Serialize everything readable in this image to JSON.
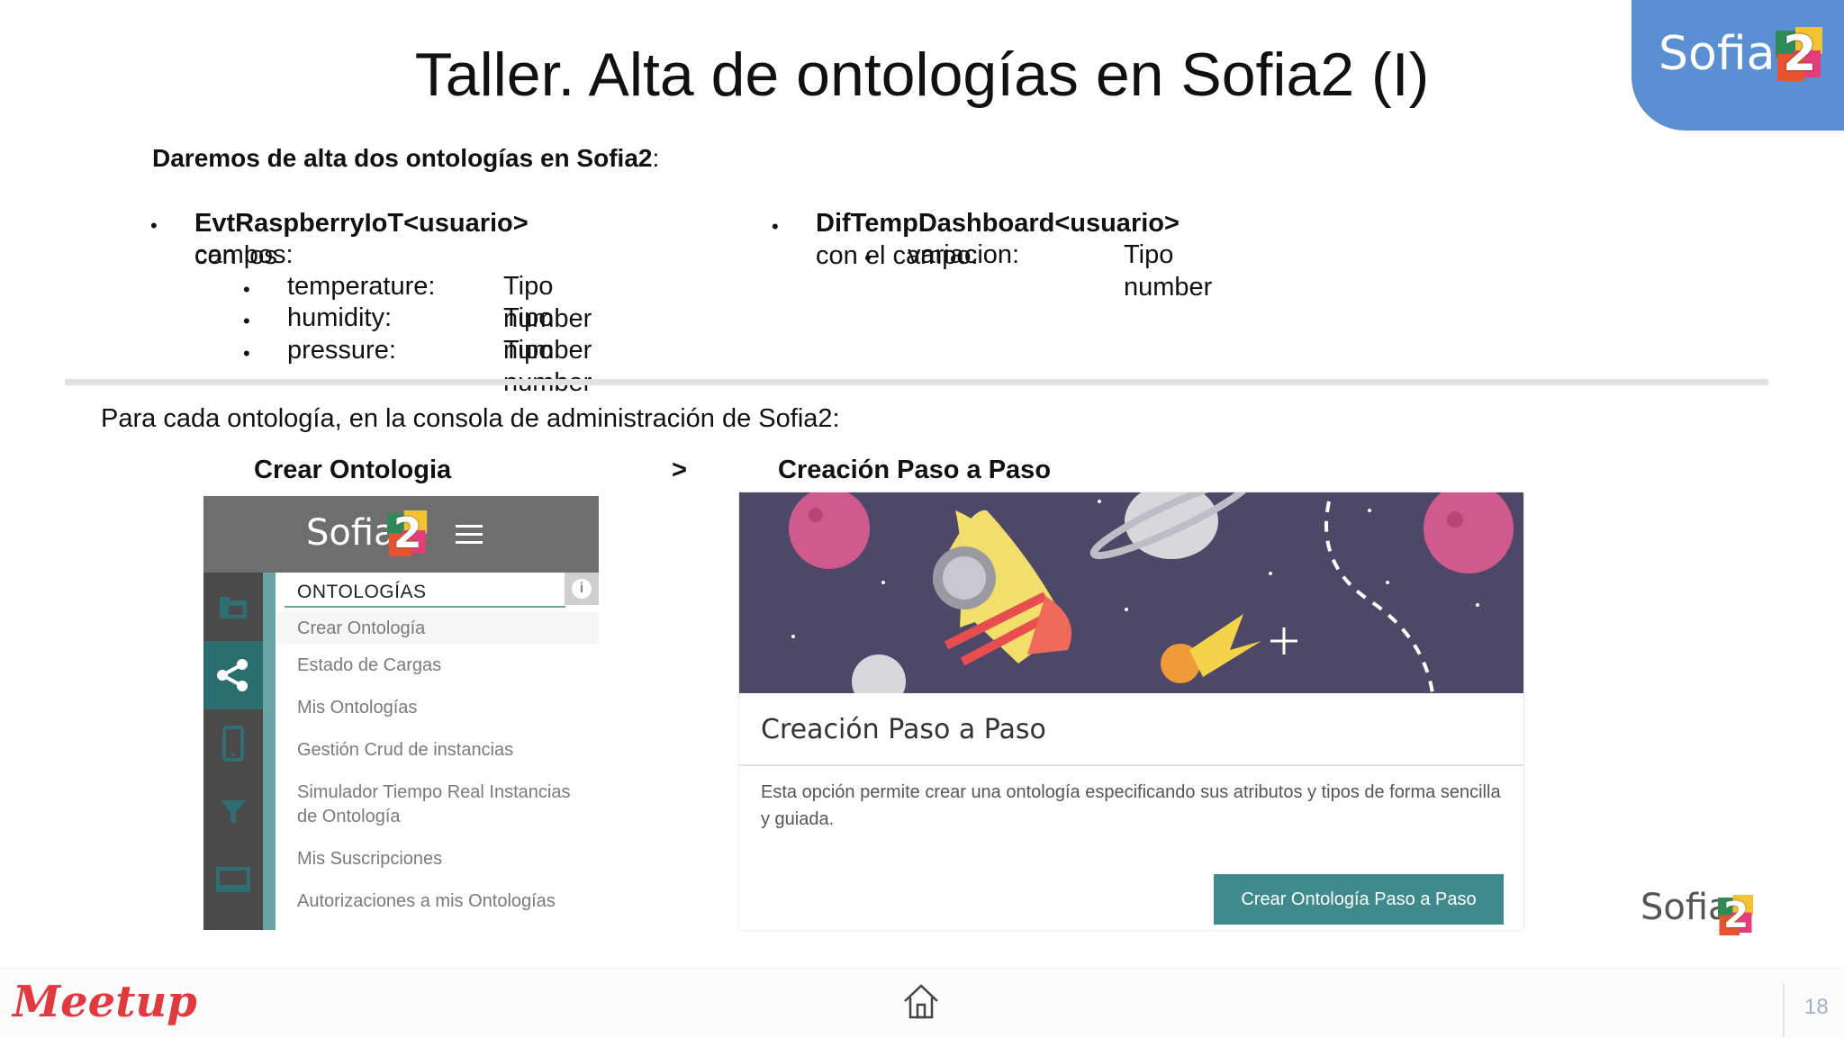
{
  "slide": {
    "title": "Taller. Alta de ontologías en Sofia2 (I)",
    "intro_bold": "Daremos de alta dos ontologías en Sofia2",
    "intro_rest": ":",
    "page_number": "18"
  },
  "left_ontology": {
    "name_bold": "EvtRaspberryIoT<usuario>",
    "name_rest": " con los",
    "line2": "campos:",
    "fields": [
      {
        "name": "temperature:",
        "type": "Tipo number"
      },
      {
        "name": "humidity:",
        "type": "Tipo number"
      },
      {
        "name": "pressure:",
        "type": "Tipo number"
      }
    ]
  },
  "right_ontology": {
    "name_bold": "DifTempDashboard<usuario>",
    "name_rest": " con el campo:",
    "fields": [
      {
        "name": "variacion:",
        "type": "Tipo number"
      }
    ]
  },
  "instructions": {
    "text": "Para cada ontología, en la consola de administración de Sofia2:",
    "step1": "Crear Ontologia",
    "arrow": ">",
    "step2": "Creación Paso a Paso"
  },
  "console_panel": {
    "brand": "Sofia",
    "brand_number": "2",
    "section_title": "ONTOLOGÍAS",
    "menu_items": [
      "Crear Ontología",
      "Estado de Cargas",
      "Mis Ontologías",
      "Gestión Crud de instancias",
      "Simulador Tiempo Real Instancias",
      "de Ontología",
      "Mis Suscripciones",
      "Autorizaciones a mis Ontologías"
    ],
    "rail_icons": [
      "folder-icon",
      "share-icon",
      "mobile-icon",
      "filter-icon",
      "monitor-icon"
    ]
  },
  "wizard_card": {
    "title": "Creación Paso a Paso",
    "description": "Esta opción permite crear una ontología especificando sus atributos y tipos de forma sencilla y guiada.",
    "button": "Crear Ontología Paso a Paso"
  },
  "branding": {
    "corner_logo": "Sofia",
    "corner_number": "2",
    "bottom_logo": "Sofia",
    "bottom_number": "2",
    "meetup_logo": "Meetup"
  },
  "colors": {
    "accent_teal": "#3f8a8c",
    "corner_blue": "#5b8fd3",
    "meetup_red": "#e0393e"
  }
}
